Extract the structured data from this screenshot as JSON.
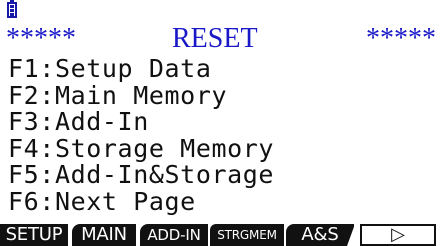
{
  "status_bar": {
    "battery_icon": "battery-icon"
  },
  "header": {
    "stars_left": "*****",
    "title": "RESET",
    "stars_right": "*****"
  },
  "menu": {
    "items": [
      {
        "label": "F1:Setup Data"
      },
      {
        "label": "F2:Main Memory"
      },
      {
        "label": "F3:Add-In"
      },
      {
        "label": "F4:Storage Memory"
      },
      {
        "label": "F5:Add-In&Storage"
      },
      {
        "label": "F6:Next Page"
      }
    ]
  },
  "function_keys": [
    {
      "label": "SETUP"
    },
    {
      "label": "MAIN"
    },
    {
      "label": "ADD-IN"
    },
    {
      "label": "STRGMEM"
    },
    {
      "label": "A&S"
    },
    {
      "label": "▷"
    }
  ],
  "colors": {
    "title_blue": "#1818c8",
    "text": "#111111",
    "key_background": "#111111"
  }
}
